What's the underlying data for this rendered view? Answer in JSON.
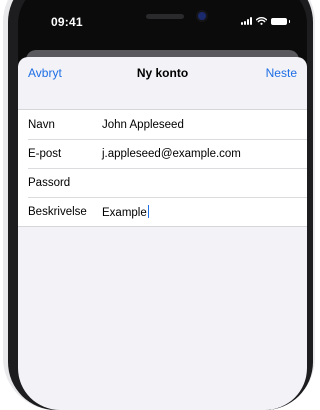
{
  "status_bar": {
    "time": "09:41"
  },
  "navigation": {
    "cancel_label": "Avbryt",
    "title": "Ny konto",
    "next_label": "Neste"
  },
  "form": {
    "fields": [
      {
        "label": "Navn",
        "value": "John Appleseed"
      },
      {
        "label": "E-post",
        "value": "j.appleseed@example.com"
      },
      {
        "label": "Passord",
        "value": ""
      },
      {
        "label": "Beskrivelse",
        "value": "Example"
      }
    ]
  },
  "icons": [
    "signal-icon",
    "wifi-icon",
    "battery-icon"
  ],
  "colors": {
    "accent": "#1f6fe5",
    "sheet_background": "#f2f2f7"
  }
}
